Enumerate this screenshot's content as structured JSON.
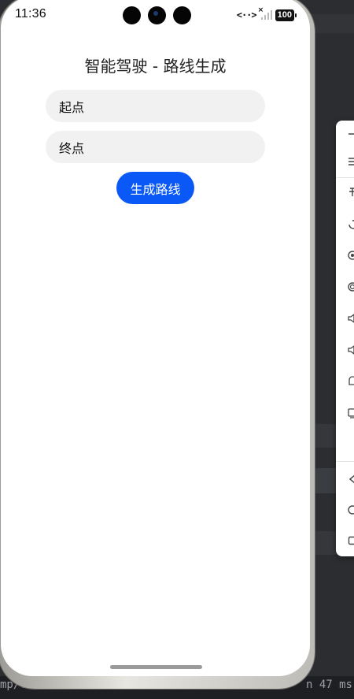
{
  "status_bar": {
    "time": "11:36",
    "net": "<··>",
    "battery": "100"
  },
  "app": {
    "title": "智能驾驶 - 路线生成",
    "start_input": {
      "placeholder": "起点"
    },
    "end_input": {
      "placeholder": "终点"
    },
    "generate_button": "生成路线"
  },
  "ide": {
    "bottom_left_text": "mp/c",
    "bottom_right_text": "n 47 ms",
    "toolbar_items": [
      "minus-icon",
      "menu-icon",
      "pin-icon",
      "rotate-icon",
      "location-icon",
      "camera-icon",
      "volume-up-icon",
      "volume-down-icon",
      "fold-icon",
      "screen-icon",
      "back-icon",
      "home-icon",
      "recent-icon"
    ]
  }
}
